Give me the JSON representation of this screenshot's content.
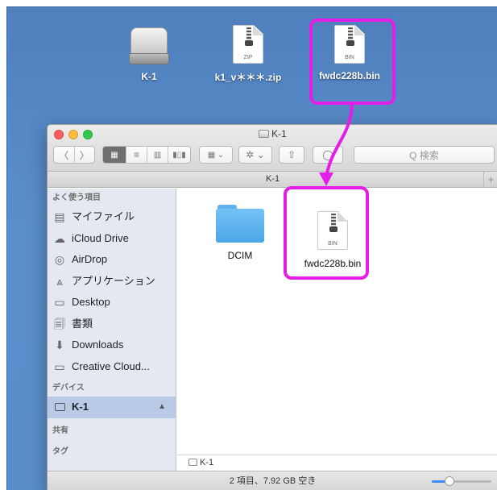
{
  "desktop": {
    "icons": [
      {
        "label": "K-1",
        "kind": "drive-icon"
      },
      {
        "label": "k1_v＊＊＊.zip",
        "kind": "zip-file-icon",
        "ext": "ZIP"
      },
      {
        "label": "fwdc228b.bin",
        "kind": "bin-file-icon",
        "ext": "BIN"
      }
    ]
  },
  "finder": {
    "title": "K-1",
    "search_placeholder": "Q 検索",
    "path_tab": "K-1",
    "path_plus": "+",
    "sidebar": {
      "favorites_header": "よく使う項目",
      "favorites": [
        {
          "label": "マイファイル",
          "icon": "all-my-files-icon",
          "glyph": "▤"
        },
        {
          "label": "iCloud Drive",
          "icon": "cloud-icon",
          "glyph": "☁"
        },
        {
          "label": "AirDrop",
          "icon": "airdrop-icon",
          "glyph": "◎"
        },
        {
          "label": "アプリケーション",
          "icon": "applications-icon",
          "glyph": "⩓"
        },
        {
          "label": "Desktop",
          "icon": "desktop-folder-icon",
          "glyph": "▭"
        },
        {
          "label": "書類",
          "icon": "documents-icon",
          "glyph": "🗐"
        },
        {
          "label": "Downloads",
          "icon": "downloads-icon",
          "glyph": "⬇"
        },
        {
          "label": "Creative Cloud...",
          "icon": "folder-icon",
          "glyph": "▭"
        }
      ],
      "devices_header": "デバイス",
      "devices": [
        {
          "label": "K-1",
          "icon": "drive-icon",
          "eject": "▲"
        }
      ],
      "shared_header": "共有",
      "tags_header": "タグ"
    },
    "items": [
      {
        "label": "DCIM",
        "kind": "folder-icon"
      },
      {
        "label": "fwdc228b.bin",
        "kind": "bin-file-icon",
        "ext": "BIN"
      }
    ],
    "path_status": "K-1",
    "status_text": "2 項目、7.92 GB 空き",
    "icon_size_level": 0.3
  },
  "colors": {
    "highlight": "#e41ee6",
    "desktop": "#5a8ecb"
  }
}
